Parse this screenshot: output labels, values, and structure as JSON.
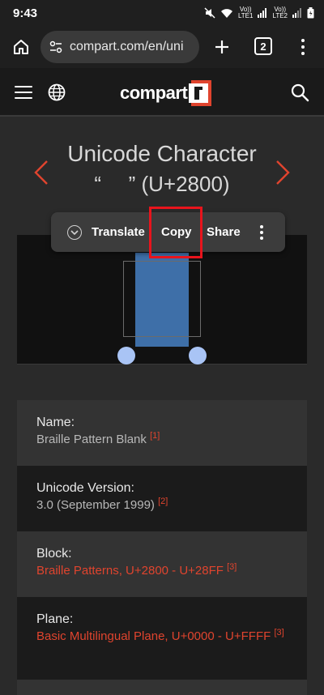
{
  "status_bar": {
    "time": "9:43",
    "sim1": "LTE1",
    "sim2": "LTE2",
    "volte1": "Vo))",
    "volte2": "Vo))"
  },
  "browser": {
    "url": "compart.com/en/uni",
    "tab_count": "2"
  },
  "site": {
    "logo_text": "compart"
  },
  "title": {
    "line1": "Unicode Character",
    "line2": "“ ⠀ ” (U+2800)"
  },
  "context_menu": {
    "translate": "Translate",
    "copy": "Copy",
    "share": "Share"
  },
  "info": [
    {
      "label": "Name:",
      "value": "Braille Pattern Blank",
      "ref": "[1]",
      "link": false
    },
    {
      "label": "Unicode Version:",
      "value": "3.0 (September 1999)",
      "ref": "[2]",
      "link": false
    },
    {
      "label": "Block:",
      "value": "Braille Patterns, U+2800 - U+28FF",
      "ref": "[3]",
      "link": true
    },
    {
      "label": "Plane:",
      "value": "Basic Multilingual Plane, U+0000 - U+FFFF",
      "ref": "[3]",
      "link": true
    }
  ],
  "colors": {
    "accent": "#e0442e",
    "highlight_box": "#e8141c",
    "glyph_fill": "#3e6fa8",
    "glyph_dot": "#a9c4f5"
  },
  "icons": [
    "home-icon",
    "site-info-icon",
    "plus-icon",
    "tabs-icon",
    "more-vert-icon",
    "hamburger-icon",
    "globe-icon",
    "search-icon",
    "chevron-left-icon",
    "chevron-right-icon",
    "translate-icon",
    "more-vert-icon"
  ]
}
